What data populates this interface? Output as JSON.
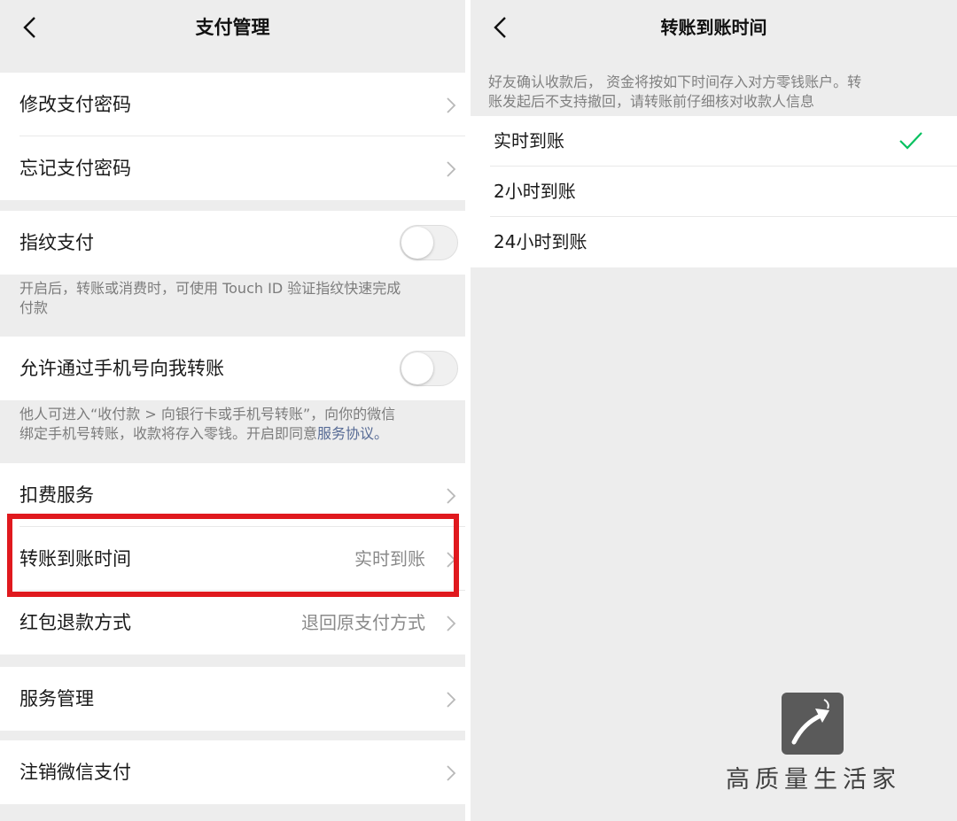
{
  "left": {
    "title": "支付管理",
    "rows": {
      "change_password": "修改支付密码",
      "forgot_password": "忘记支付密码",
      "fingerprint": "指纹支付",
      "phone_transfer": "允许通过手机号向我转账",
      "deduction": "扣费服务",
      "arrival_time": "转账到账时间",
      "arrival_time_value": "实时到账",
      "refund": "红包退款方式",
      "refund_value": "退回原支付方式",
      "service_mgmt": "服务管理",
      "cancel": "注销微信支付"
    },
    "notes": {
      "fingerprint_line1": "开启后，转账或消费时，可使用 Touch ID 验证指纹快速完成",
      "fingerprint_line2": "付款",
      "phone_line1": "他人可进入“收付款 > 向银行卡或手机号转账”，向你的微信",
      "phone_line2": "绑定手机号转账，收款将存入零钱。开启即同意",
      "phone_link": "服务协议",
      "phone_end": "。"
    },
    "toggles": {
      "fingerprint": false,
      "phone_transfer": false
    }
  },
  "right": {
    "title": "转账到账时间",
    "note_line1": "好友确认收款后， 资金将按如下时间存入对方零钱账户。转",
    "note_line2": "账发起后不支持撤回，请转账前仔细核对收款人信息",
    "options": [
      "实时到账",
      "2小时到账",
      "24小时到账"
    ],
    "selected_index": 0
  },
  "watermark": {
    "text": "高质量生活家"
  },
  "colors": {
    "highlight": "#e0191e",
    "check": "#07c160",
    "link": "#576b95",
    "background": "#ededed"
  }
}
